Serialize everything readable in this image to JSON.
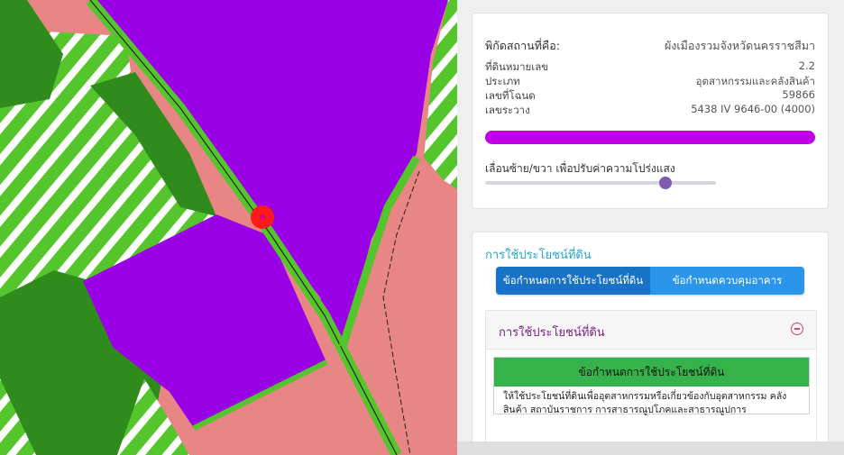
{
  "map": {
    "colors": {
      "industrial": "#9a00e6",
      "commercial": "#e88585",
      "green": "#54c62c",
      "rural": "#2f8c1c",
      "hatch_stripe": "#ffffff"
    },
    "marker_icon": "location-marker-icon"
  },
  "info": {
    "label": "พิกัดสถานที่คือ:",
    "plan_name": "ผังเมืองรวมจังหวัดนครราชสีมา",
    "rows": [
      {
        "key": "ที่ดินหมายเลข",
        "value": "2.2"
      },
      {
        "key": "ประเภท",
        "value": "อุตสาหกรรมและคลังสินค้า"
      },
      {
        "key": "เลขที่โฉนด",
        "value": "59866"
      },
      {
        "key": "เลขระวาง",
        "value": "5438 IV 9646-00 (4000)"
      }
    ],
    "zone_color": "#bf00e6",
    "slider_label": "เลื่อนซ้าย/ขวา เพื่อปรับค่าความโปร่งแสง",
    "slider_value": 0.78
  },
  "landuse": {
    "title": "การใช้ประโยชน์ที่ดิน",
    "tabs": [
      "ข้อกำหนดการใช้ประโยชน์ที่ดิน",
      "ข้อกำหนดควบคุมอาคาร"
    ],
    "accordion_title": "การใช้ประโยชน์ที่ดิน",
    "toggle_icon": "collapse-minus-icon",
    "rule_header": "ข้อกำหนดการใช้ประโยชน์ที่ดิน",
    "rule_body": "ให้ใช้ประโยชน์ที่ดินเพื่ออุตสาหกรรมหรือเกี่ยวข้องกับอุตสาหกรรม คลังสินค้า สถาบันราชการ การสาธารณูปโภคและสาธารณูปการ"
  }
}
